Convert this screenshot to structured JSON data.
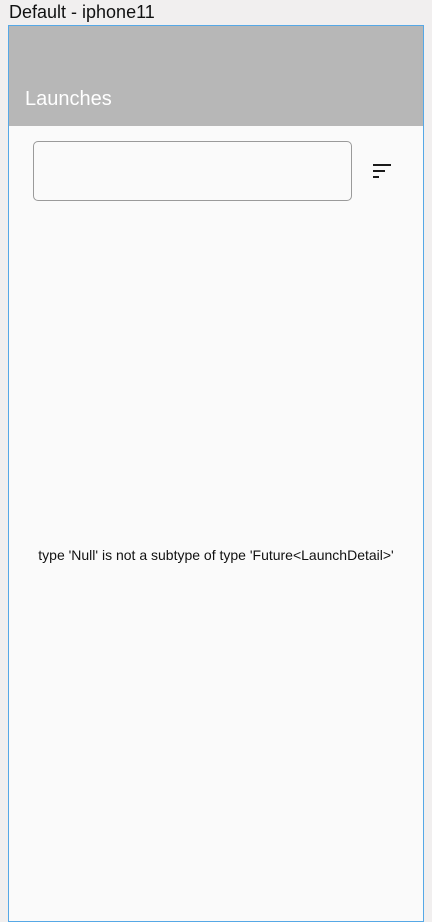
{
  "window": {
    "title": "Default - iphone11"
  },
  "app_bar": {
    "title": "Launches",
    "background_color": "#b7b7b7"
  },
  "search": {
    "value": "",
    "placeholder": ""
  },
  "filter_button": {
    "icon": "sort-icon"
  },
  "body": {
    "error_message": "type 'Null' is not a subtype of type 'Future<LaunchDetail>'"
  },
  "colors": {
    "frame_border": "#56a8e6",
    "page_background": "#fafafa"
  }
}
